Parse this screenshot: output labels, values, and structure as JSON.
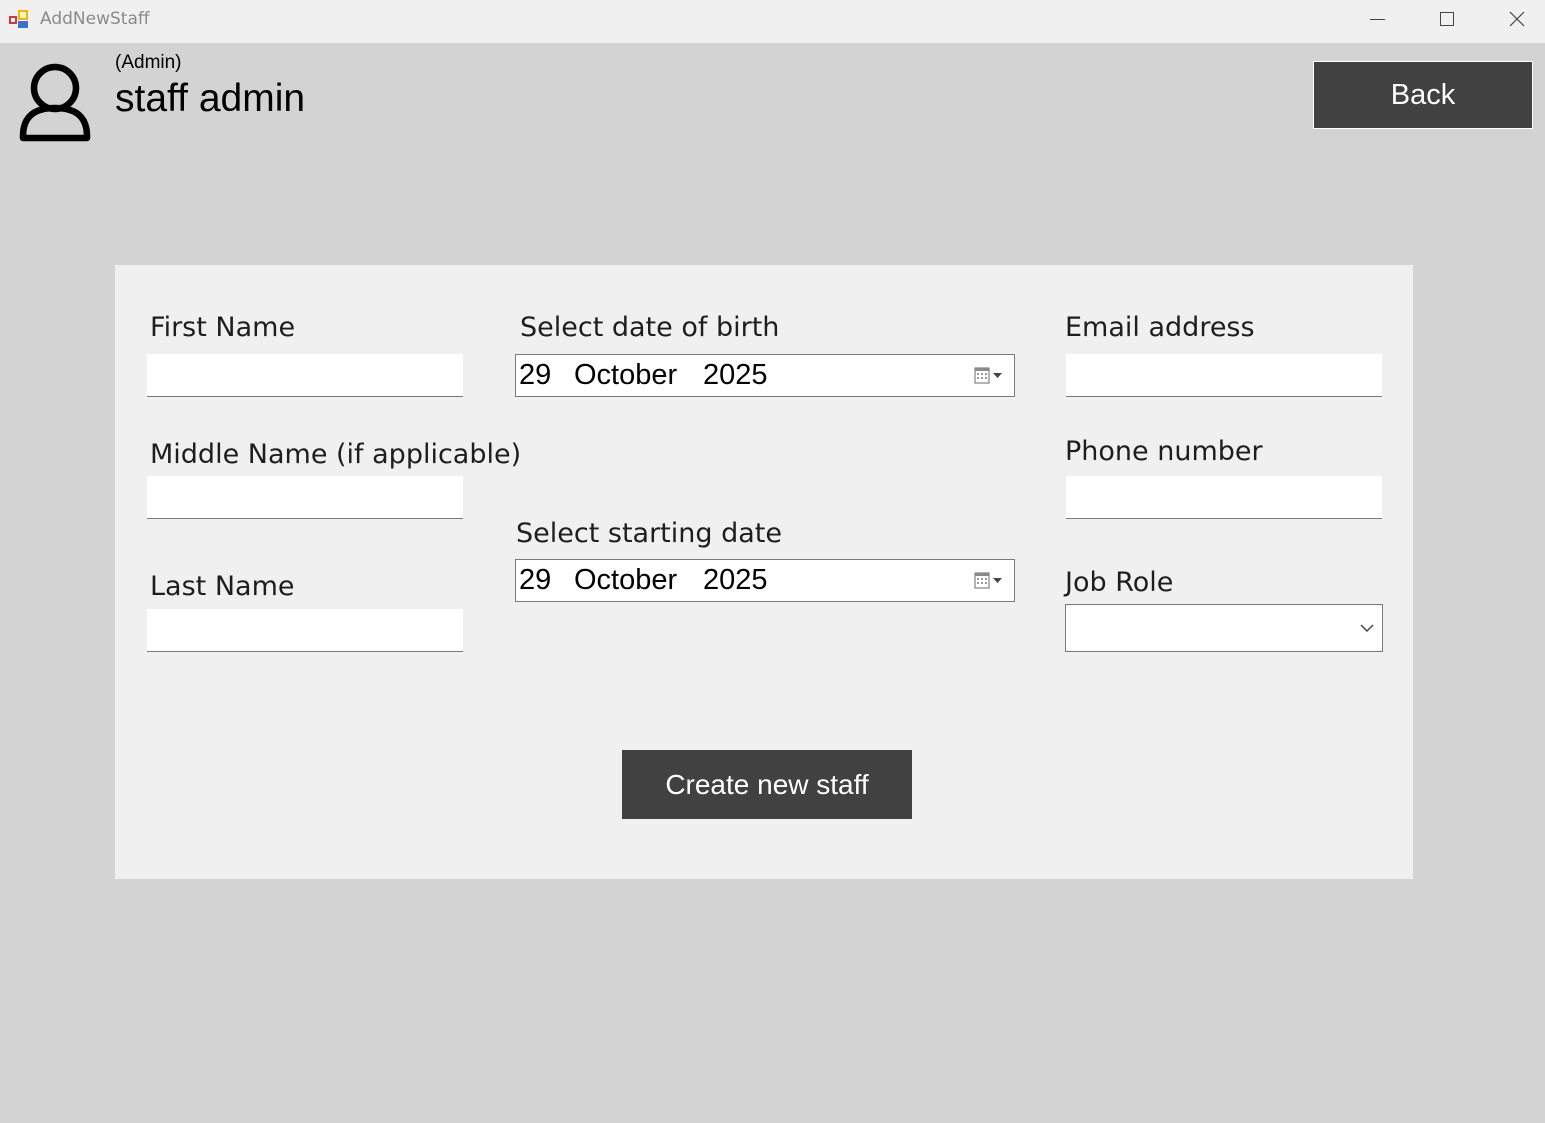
{
  "window": {
    "title": "AddNewStaff",
    "controls": [
      "minimize",
      "maximize",
      "close"
    ]
  },
  "header": {
    "role": "(Admin)",
    "user_name": "staff admin",
    "user_icon": "user-icon",
    "back_label": "Back"
  },
  "form": {
    "first_name": {
      "label": "First Name",
      "value": ""
    },
    "middle_name": {
      "label": "Middle Name (if applicable)",
      "value": ""
    },
    "last_name": {
      "label": "Last Name",
      "value": ""
    },
    "date_of_birth": {
      "label": "Select date of birth",
      "day": "29",
      "month": "October",
      "year": "2025"
    },
    "starting_date": {
      "label": "Select starting date",
      "day": "29",
      "month": "October",
      "year": "2025"
    },
    "email": {
      "label": "Email address",
      "value": ""
    },
    "phone": {
      "label": "Phone number",
      "value": ""
    },
    "job_role": {
      "label": "Job Role",
      "selected": ""
    },
    "submit_label": "Create new staff"
  },
  "colors": {
    "background": "#d3d3d3",
    "panel": "#f0f0f0",
    "titlebar": "#f0f0f0",
    "button": "#414141",
    "button_text": "#ffffff"
  }
}
